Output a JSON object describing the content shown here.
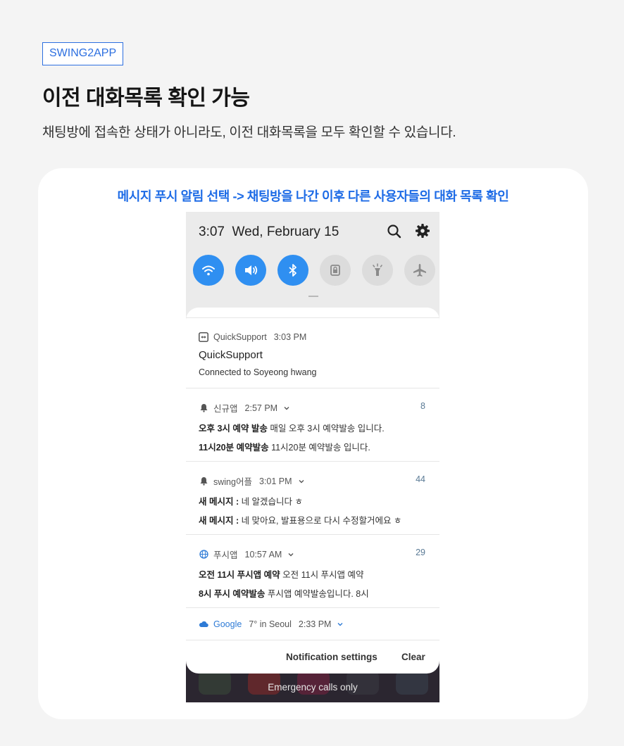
{
  "header": {
    "tag": "SWING2APP",
    "title": "이전 대화목록 확인 가능",
    "subtitle": "채팅방에 접속한 상태가 아니라도, 이전 대화목록을 모두 확인할 수 있습니다."
  },
  "card": {
    "caption": "메시지 푸시 알림 선택 -> 채팅방을 나간 이후 다른 사용자들의 대화 목록 확인"
  },
  "quick_settings": {
    "time": "3:07",
    "date": "Wed, February 15",
    "toggles": [
      {
        "icon": "wifi-icon",
        "state": "on"
      },
      {
        "icon": "volume-icon",
        "state": "on"
      },
      {
        "icon": "bluetooth-icon",
        "state": "on"
      },
      {
        "icon": "lock-icon",
        "state": "off"
      },
      {
        "icon": "flashlight-icon",
        "state": "off"
      },
      {
        "icon": "airplane-icon",
        "state": "off"
      }
    ]
  },
  "notifications": {
    "quicksupport": {
      "app": "QuickSupport",
      "time": "3:03 PM",
      "title": "QuickSupport",
      "body": "Connected to Soyeong hwang"
    },
    "n1": {
      "app": "신규앱",
      "time": "2:57 PM",
      "count": "8",
      "line1_bold": "오후 3시 예약 발송",
      "line1_text": " 매일 오후 3시 예약발송 입니다.",
      "line2_bold": "11시20분 예약발송",
      "line2_text": " 11시20분 예약발송 입니다."
    },
    "n2": {
      "app": "swing어플",
      "time": "3:01 PM",
      "count": "44",
      "line1_bold": "새 메시지 :",
      "line1_text": "  네 알겠습니다 ㅎ",
      "line2_bold": "새 메시지 :",
      "line2_text": "  네 맞아요, 발표용으로 다시 수정할거에요 ㅎ"
    },
    "n3": {
      "app": "푸시앱",
      "time": "10:57 AM",
      "count": "29",
      "line1_bold": "오전 11시 푸시앱 예약",
      "line1_text": " 오전 11시 푸시앱 예약",
      "line2_bold": "8시 푸시 예약발송",
      "line2_text": " 푸시앱 예약발송입니다. 8시"
    },
    "google": {
      "app": "Google",
      "weather": "7° in Seoul",
      "time": "2:33 PM"
    }
  },
  "footer": {
    "settings_label": "Notification settings",
    "clear_label": "Clear"
  },
  "lockscreen": {
    "emergency": "Emergency calls only"
  },
  "colors": {
    "accent": "#2c6fe0",
    "toggle_on": "#2f8ff1",
    "caption": "#1d6be6"
  }
}
